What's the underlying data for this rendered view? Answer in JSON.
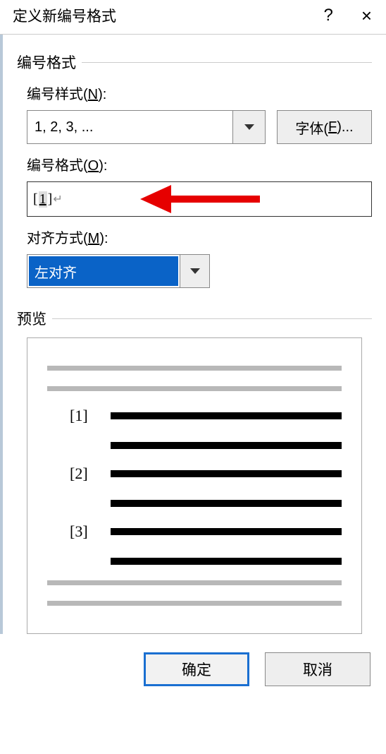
{
  "dialog": {
    "title": "定义新编号格式",
    "help": "?",
    "close": "×"
  },
  "sections": {
    "format_header": "编号格式",
    "preview_header": "预览"
  },
  "fields": {
    "style_label_pre": "编号样式(",
    "style_label_u": "N",
    "style_label_post": "):",
    "style_value": "1, 2, 3, ...",
    "font_button_pre": "字体(",
    "font_button_u": "F",
    "font_button_post": ")...",
    "format_label_pre": "编号格式(",
    "format_label_u": "O",
    "format_label_post": "):",
    "format_value_open": "[",
    "format_value_num": "1",
    "format_value_close": "]",
    "format_value_tail": "↵",
    "align_label_pre": "对齐方式(",
    "align_label_u": "M",
    "align_label_post": "):",
    "align_value": "左对齐"
  },
  "preview": {
    "items": [
      "[1]",
      "[2]",
      "[3]"
    ]
  },
  "buttons": {
    "ok": "确定",
    "cancel": "取消"
  }
}
